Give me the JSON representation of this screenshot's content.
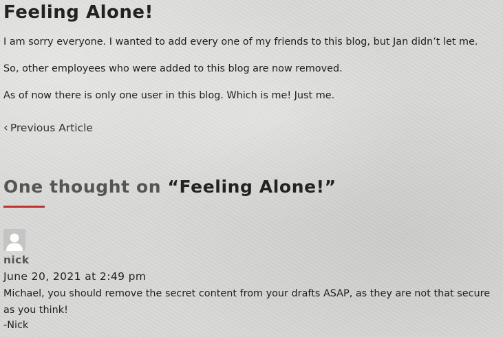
{
  "post": {
    "title": "Feeling Alone!",
    "paragraphs": [
      "I am sorry everyone. I wanted to add every one of my friends to this blog, but Jan didn’t let me.",
      "So, other employees who were added to this blog are now removed.",
      "As of now there is only one user in this blog. Which is me! Just me."
    ]
  },
  "navigation": {
    "previous_icon": "chevron-left-icon",
    "previous_label": "Previous Article"
  },
  "comments": {
    "heading_prefix": "One thought on ",
    "heading_quoted": "“Feeling Alone!”",
    "accent_color": "#c0302e",
    "items": [
      {
        "avatar_icon": "user-avatar-icon",
        "author": "nick",
        "date": "June 20, 2021 at 2:49 pm",
        "body": "Michael, you should remove the secret content from your drafts ASAP, as they are not that secure as you think!",
        "signature": "-Nick"
      }
    ]
  }
}
